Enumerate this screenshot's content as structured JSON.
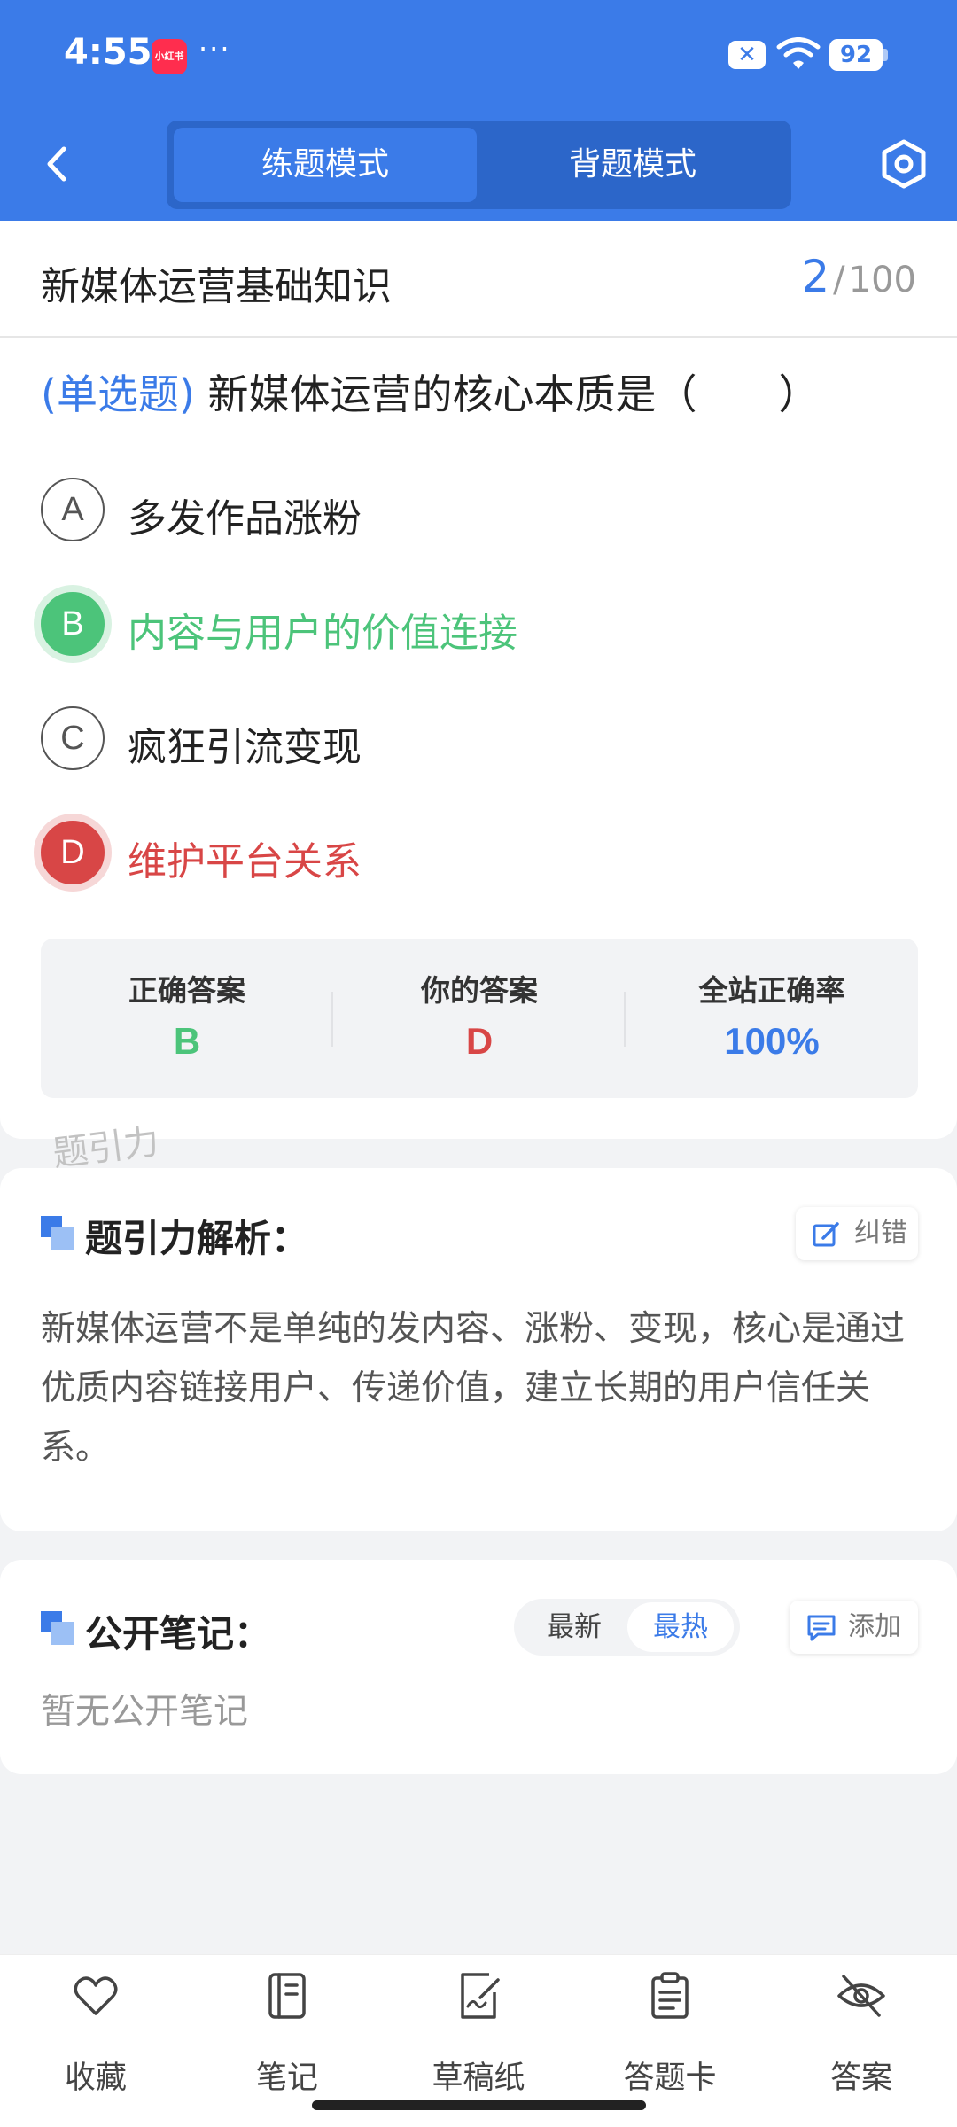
{
  "status_bar": {
    "time": "4:55",
    "app_badge": "小红书",
    "more": "···",
    "battery": "92"
  },
  "header": {
    "mode_practice": "练题模式",
    "mode_memorize": "背题模式"
  },
  "question": {
    "bank_title": "新媒体运营基础知识",
    "current": "2",
    "separator": "/",
    "total": "100",
    "type_label": "(单选题)",
    "stem": "新媒体运营的核心本质是（　　）",
    "options": [
      {
        "letter": "A",
        "text": "多发作品涨粉",
        "state": "normal"
      },
      {
        "letter": "B",
        "text": "内容与用户的价值连接",
        "state": "correct"
      },
      {
        "letter": "C",
        "text": "疯狂引流变现",
        "state": "normal"
      },
      {
        "letter": "D",
        "text": "维护平台关系",
        "state": "wrong"
      }
    ]
  },
  "stats": {
    "correct_label": "正确答案",
    "correct_value": "B",
    "yours_label": "你的答案",
    "yours_value": "D",
    "rate_label": "全站正确率",
    "rate_value": "100%"
  },
  "watermark": "题引力",
  "analysis": {
    "title": "题引力解析：",
    "report_button": "纠错",
    "text": "新媒体运营不是单纯的发内容、涨粉、变现，核心是通过优质内容链接用户、传递价值，建立长期的用户信任关系。"
  },
  "notes": {
    "title": "公开笔记：",
    "sort_newest": "最新",
    "sort_hot": "最热",
    "add_button": "添加",
    "empty_text": "暂无公开笔记"
  },
  "bottom_nav": [
    {
      "label": "收藏",
      "icon": "heart-icon"
    },
    {
      "label": "笔记",
      "icon": "notebook-icon"
    },
    {
      "label": "草稿纸",
      "icon": "draft-icon"
    },
    {
      "label": "答题卡",
      "icon": "clipboard-icon"
    },
    {
      "label": "答案",
      "icon": "eye-off-icon"
    }
  ],
  "colors": {
    "primary": "#3b7be8",
    "correct": "#4cc47a",
    "wrong": "#d84646"
  }
}
